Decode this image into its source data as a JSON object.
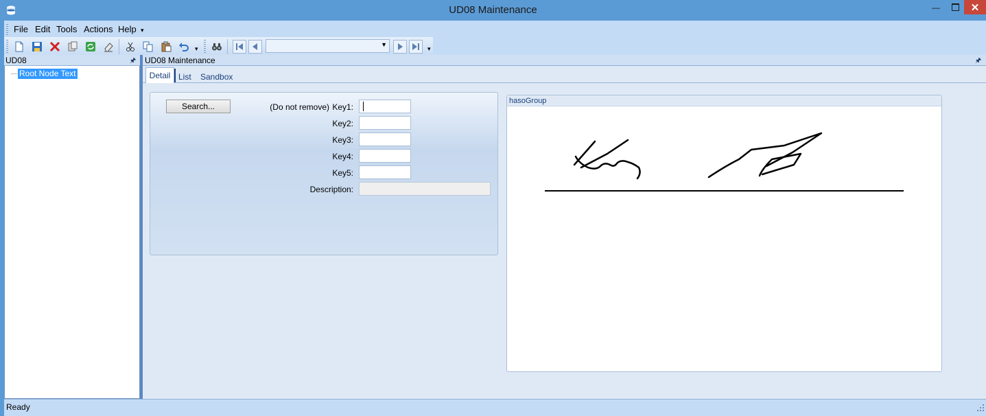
{
  "window": {
    "title": "UD08 Maintenance"
  },
  "menu": [
    "File",
    "Edit",
    "Tools",
    "Actions",
    "Help"
  ],
  "toolbar": {
    "icons": [
      "new-icon",
      "save-icon",
      "delete-icon",
      "copy-record-icon",
      "refresh-icon",
      "clear-icon",
      "cut-icon",
      "copy-icon",
      "paste-icon",
      "undo-icon",
      "search-binoculars-icon",
      "first-record-icon",
      "previous-record-icon",
      "next-record-icon",
      "last-record-icon"
    ],
    "nav_value": ""
  },
  "tree_panel": {
    "title": "UD08",
    "root_node": "Root Node Text"
  },
  "main_panel": {
    "title": "UD08 Maintenance",
    "tabs": [
      "Detail",
      "List",
      "Sandbox"
    ],
    "active_tab": "Detail"
  },
  "form": {
    "search_button": "Search...",
    "do_not_remove": "(Do not remove)",
    "fields": [
      {
        "label": "Key1:",
        "value": ""
      },
      {
        "label": "Key2:",
        "value": ""
      },
      {
        "label": "Key3:",
        "value": ""
      },
      {
        "label": "Key4:",
        "value": ""
      },
      {
        "label": "Key5:",
        "value": ""
      }
    ],
    "description_label": "Description:",
    "description_value": ""
  },
  "haso_group": {
    "title": "hasoGroup"
  },
  "status": {
    "text": "Ready"
  },
  "colors": {
    "titlebar": "#5b9bd5",
    "close": "#c7473b",
    "selection": "#3399ff",
    "panel": "#dfe9f5"
  }
}
